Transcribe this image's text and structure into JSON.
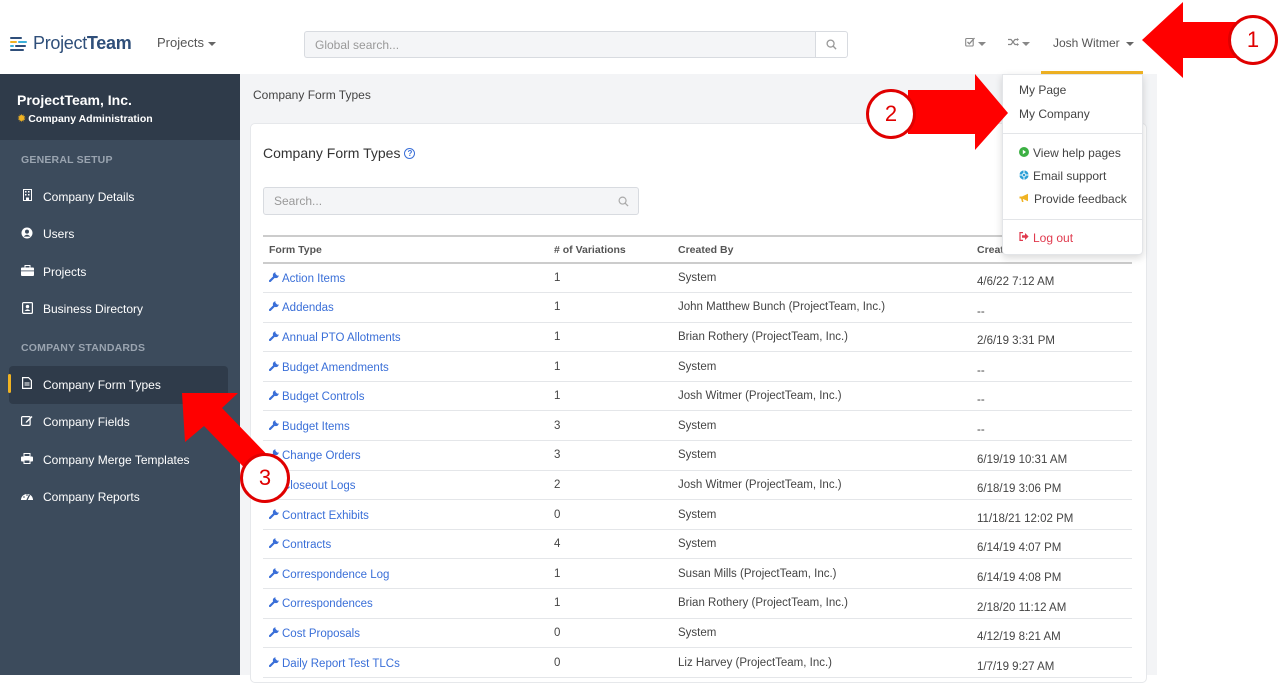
{
  "header": {
    "logo_text_light": "Project",
    "logo_text_bold": "Team",
    "projects_menu": "Projects",
    "global_search_placeholder": "Global search...",
    "tasks_icon": "checkbox-icon",
    "switch_icon": "shuffle-icon",
    "user_name": "Josh Witmer"
  },
  "user_dropdown": {
    "items": [
      {
        "label": "My Page",
        "icon": null
      },
      {
        "label": "My Company",
        "icon": null
      },
      {
        "label": "View help pages",
        "icon": "play-circle-icon",
        "icon_color": "#3cb043"
      },
      {
        "label": "Email support",
        "icon": "life-ring-icon",
        "icon_color": "#2a9fd6"
      },
      {
        "label": "Provide feedback",
        "icon": "bullhorn-icon",
        "icon_color": "#f0b323"
      },
      {
        "label": "Log out",
        "icon": "sign-out-icon",
        "icon_color": "#e03a4e"
      }
    ]
  },
  "sidebar": {
    "org_name": "ProjectTeam, Inc.",
    "org_sub": "Company Administration",
    "sections": [
      {
        "label": "GENERAL SETUP",
        "items": [
          {
            "label": "Company Details",
            "icon": "building-icon"
          },
          {
            "label": "Users",
            "icon": "user-circle-icon"
          },
          {
            "label": "Projects",
            "icon": "briefcase-icon"
          },
          {
            "label": "Business Directory",
            "icon": "address-book-icon"
          }
        ]
      },
      {
        "label": "COMPANY STANDARDS",
        "items": [
          {
            "label": "Company Form Types",
            "icon": "file-text-icon",
            "active": true
          },
          {
            "label": "Company Fields",
            "icon": "edit-icon"
          },
          {
            "label": "Company Merge Templates",
            "icon": "print-icon"
          },
          {
            "label": "Company Reports",
            "icon": "dashboard-icon"
          }
        ]
      }
    ]
  },
  "main": {
    "breadcrumb": "Company Form Types",
    "card_title": "Company Form Types",
    "search_placeholder": "Search...",
    "columns": [
      "Form Type",
      "# of Variations",
      "Created By",
      "Created"
    ],
    "rows": [
      {
        "name": "Action Items",
        "variations": "1",
        "created_by": "System",
        "created": "4/6/22 7:12 AM"
      },
      {
        "name": "Addendas",
        "variations": "1",
        "created_by": "John Matthew Bunch (ProjectTeam, Inc.)",
        "created": "--"
      },
      {
        "name": "Annual PTO Allotments",
        "variations": "1",
        "created_by": "Brian Rothery (ProjectTeam, Inc.)",
        "created": "2/6/19 3:31 PM"
      },
      {
        "name": "Budget Amendments",
        "variations": "1",
        "created_by": "System",
        "created": "--"
      },
      {
        "name": "Budget Controls",
        "variations": "1",
        "created_by": "Josh Witmer (ProjectTeam, Inc.)",
        "created": "--"
      },
      {
        "name": "Budget Items",
        "variations": "3",
        "created_by": "System",
        "created": "--"
      },
      {
        "name": "Change Orders",
        "variations": "3",
        "created_by": "System",
        "created": "6/19/19 10:31 AM"
      },
      {
        "name": "Closeout Logs",
        "variations": "2",
        "created_by": "Josh Witmer (ProjectTeam, Inc.)",
        "created": "6/18/19 3:06 PM"
      },
      {
        "name": "Contract Exhibits",
        "variations": "0",
        "created_by": "System",
        "created": "11/18/21 12:02 PM"
      },
      {
        "name": "Contracts",
        "variations": "4",
        "created_by": "System",
        "created": "6/14/19 4:07 PM"
      },
      {
        "name": "Correspondence Log",
        "variations": "1",
        "created_by": "Susan Mills (ProjectTeam, Inc.)",
        "created": "6/14/19 4:08 PM"
      },
      {
        "name": "Correspondences",
        "variations": "1",
        "created_by": "Brian Rothery (ProjectTeam, Inc.)",
        "created": "2/18/20 11:12 AM"
      },
      {
        "name": "Cost Proposals",
        "variations": "0",
        "created_by": "System",
        "created": "4/12/19 8:21 AM"
      },
      {
        "name": "Daily Report Test TLCs",
        "variations": "0",
        "created_by": "Liz Harvey (ProjectTeam, Inc.)",
        "created": "1/7/19 9:27 AM"
      }
    ]
  },
  "annotations": [
    {
      "number": "1",
      "target": "user-menu"
    },
    {
      "number": "2",
      "target": "My Company"
    },
    {
      "number": "3",
      "target": "Company Form Types"
    }
  ],
  "colors": {
    "accent": "#f0b323",
    "link": "#3a6fd8",
    "sidebar_bg": "#3c4b5c",
    "sidebar_head_bg": "#2f3b4a",
    "annotation_red": "#e00000",
    "logout_red": "#e03a4e"
  }
}
